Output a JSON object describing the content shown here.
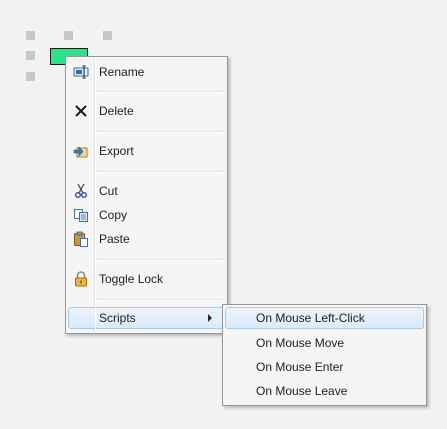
{
  "context_menu": {
    "items": [
      {
        "label": "Rename",
        "icon": "rename-icon"
      },
      {
        "label": "Delete",
        "icon": "delete-icon"
      },
      {
        "label": "Export",
        "icon": "export-icon"
      },
      {
        "label": "Cut",
        "icon": "cut-icon"
      },
      {
        "label": "Copy",
        "icon": "copy-icon"
      },
      {
        "label": "Paste",
        "icon": "paste-icon"
      },
      {
        "label": "Toggle Lock",
        "icon": "lock-icon"
      },
      {
        "label": "Scripts",
        "icon": "submenu-arrow-icon",
        "highlighted": true
      }
    ]
  },
  "scripts_submenu": {
    "items": [
      {
        "label": "On Mouse Left-Click",
        "highlighted": true
      },
      {
        "label": "On Mouse Move"
      },
      {
        "label": "On Mouse Enter"
      },
      {
        "label": "On Mouse Leave"
      }
    ]
  },
  "colors": {
    "shape_fill": "#2de38a",
    "background": "#f2f2f2",
    "menu_background": "#f5f5f5",
    "highlight": "#d9ebf9",
    "highlight_border": "#aacbe9"
  }
}
